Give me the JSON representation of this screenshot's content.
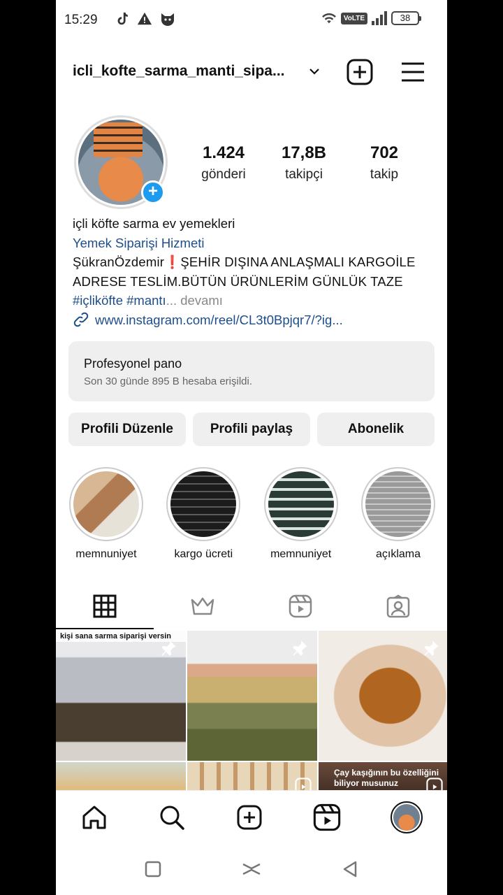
{
  "status_bar": {
    "time": "15:29",
    "network_label": "VoLTE",
    "battery": "38",
    "icons_left": [
      "tiktok-icon",
      "warning-icon",
      "cat-icon"
    ],
    "icons_right": [
      "wifi-icon",
      "volte-icon",
      "signal-icon",
      "battery-icon"
    ]
  },
  "header": {
    "username": "icli_kofte_sarma_manti_sipa...",
    "icons": [
      "chevron-down-icon",
      "create-post-icon",
      "menu-icon"
    ]
  },
  "stats": [
    {
      "value": "1.424",
      "label": "gönderi"
    },
    {
      "value": "17,8B",
      "label": "takipçi"
    },
    {
      "value": "702",
      "label": "takip"
    }
  ],
  "bio": {
    "name": "içli köfte sarma ev yemekleri",
    "category": "Yemek Siparişi Hizmeti",
    "line1": "ŞükranÖzdemir❗ŞEHİR DIŞINA ANLAŞMALI KARGOİLE",
    "line2": "ADRESE TESLİM.BÜTÜN ÜRÜNLERİM GÜNLÜK TAZE",
    "hashtags": "#içliköfte #mantı",
    "more": "... devamı",
    "link": "www.instagram.com/reel/CL3t0Bpjqr7/?ig..."
  },
  "professional": {
    "title": "Profesyonel pano",
    "subtitle": "Son 30 günde 895 B hesaba erişildi."
  },
  "buttons": {
    "edit": "Profili Düzenle",
    "share": "Profili paylaş",
    "subscribe": "Abonelik"
  },
  "highlights": [
    {
      "label": "memnuniyet",
      "color": "#b98a66"
    },
    {
      "label": "kargo ücreti",
      "color": "#1b1b1b"
    },
    {
      "label": "memnuniyet",
      "color": "#2a3a34"
    },
    {
      "label": "açıklama",
      "color": "#9a9a9a"
    }
  ],
  "tabs": [
    "grid-icon",
    "crown-icon",
    "reels-icon",
    "tagged-icon"
  ],
  "grid": {
    "cell1_caption": "kişi sana sarma siparişi versin",
    "cell6_caption": "Çay kaşığının bu özelliğini biliyor musunuz"
  },
  "bottom_nav": [
    "home-icon",
    "search-icon",
    "add-icon",
    "reels-icon",
    "profile-avatar"
  ],
  "system_nav": [
    "recents-icon",
    "home-gesture-icon",
    "back-icon"
  ],
  "colors": {
    "accent_blue": "#1d9bf0",
    "link_blue": "#1e4e8a"
  }
}
